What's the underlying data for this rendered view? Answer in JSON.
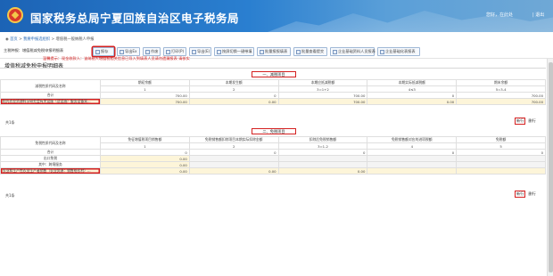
{
  "header": {
    "title": "国家税务总局宁夏回族自治区电子税务局",
    "user": "您好，在此处",
    "exit": "| 退出"
  },
  "breadcrumb": {
    "home": "首页",
    "sep1": " > ",
    "section": "我要申报选组织",
    "sep2": " > ",
    "current": "增值税一般纳税人申报"
  },
  "toolbar": {
    "label": "主税种报：增值税减免税申报明细表",
    "buttons": [
      "报存",
      "导出Ex",
      "作废",
      "打印(P)",
      "导出(E)",
      "按屏切换一键带填",
      "批量报报填表",
      "批量查看提交",
      "企业基础资料人员报表",
      "企业基础化表报表"
    ]
  },
  "tip": "温馨提示：现金收款人：该纳税人增值税相关信息已导入到填表人员请勿遗漏报表 请核实",
  "sheet_title": "增值税减免税申报明细表",
  "section1": {
    "heading": "一、减税项目",
    "cols": [
      "减税性质代码及名称",
      "期初余额",
      "本期发生额",
      "本期应抵减税额",
      "本期实际抵减税额",
      "期末余额"
    ],
    "nums": [
      "",
      "1",
      "2",
      "3=1+2",
      "4≤3",
      "5=3-4"
    ],
    "total_label": "合计",
    "total": [
      "700.00",
      "0",
      "700.00",
      "0",
      "700.00"
    ],
    "row_name": "阳光农业资源科学研究会有关设施（及设施）服务设备采...",
    "row": [
      "700.00",
      "0.00",
      "700.00",
      "0.00",
      "700.00"
    ],
    "footer": "共1条",
    "add": "新行",
    "del": "删行"
  },
  "section2": {
    "heading": "二、免税项目",
    "cols": [
      "免税性质代码及名称",
      "免征增值税项目销售额",
      "免税销售额扣除项目本期实际扣除金额",
      "扣除后免税销售额",
      "免税销售额对应的进项税额",
      "免税额"
    ],
    "nums": [
      "",
      "1",
      "2",
      "3=1-2",
      "4",
      "5"
    ],
    "total_label": "合计",
    "total": [
      "0",
      "0",
      "0",
      "0",
      "0"
    ],
    "export_label": "出口免税",
    "export_val": "0.00",
    "intl_label": "其中：跨境服务",
    "intl_val": "0.00",
    "row_name": "农业和生产性农业生产者销售（农业资源：销售给农村）...",
    "row": [
      "0.00",
      "0.00",
      "0.00",
      "",
      ""
    ],
    "footer": "共1条",
    "add": "新行",
    "del": "删行"
  }
}
